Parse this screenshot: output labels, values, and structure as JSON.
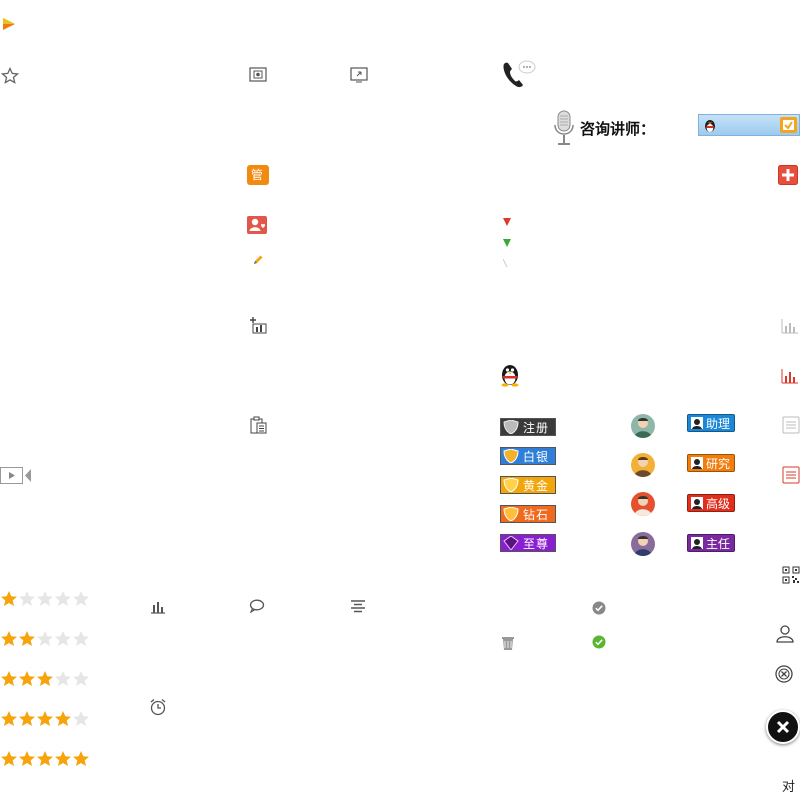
{
  "consult": {
    "label": "咨询讲师："
  },
  "member_badges": [
    {
      "label": "注册",
      "color": "#3a3a3a"
    },
    {
      "label": "白银",
      "color": "#2f7fd8"
    },
    {
      "label": "黄金",
      "color": "#f3a50c"
    },
    {
      "label": "钻石",
      "color": "#f06a1e"
    },
    {
      "label": "至尊",
      "color": "#8a1fd1"
    }
  ],
  "rank_badges": [
    {
      "label": "助理",
      "color": "#1b87d6"
    },
    {
      "label": "研究",
      "color": "#f07d0d"
    },
    {
      "label": "高级",
      "color": "#e02f1c"
    },
    {
      "label": "主任",
      "color": "#7a2aa0"
    }
  ],
  "star_ratings": [
    1,
    2,
    3,
    4,
    5
  ],
  "manage_badge": {
    "label": "管"
  },
  "footer_char": {
    "label": "对"
  },
  "colors": {
    "star_on": "#f7a40c",
    "star_off": "#e6e6e6",
    "accent_red": "#e84e3c",
    "qq_bar": "#a8d0f2"
  }
}
